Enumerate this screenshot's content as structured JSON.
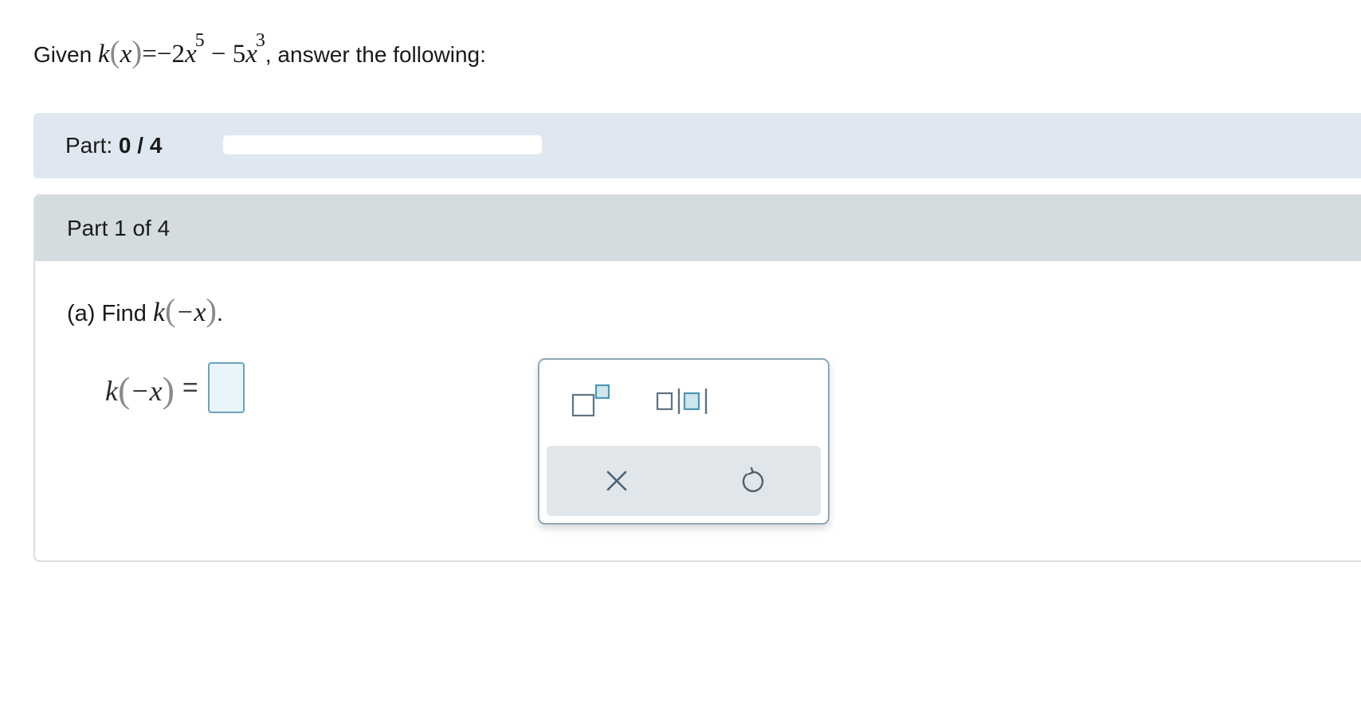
{
  "problem": {
    "prefix": "Given",
    "func_name": "k",
    "var": "x",
    "equals": "=",
    "minus1": "−",
    "coef1": "2",
    "exp1": "5",
    "minus2": "−",
    "coef2": "5",
    "exp2": "3",
    "suffix": ", answer the following:"
  },
  "progress": {
    "label": "Part:",
    "value_text": "0 / 4",
    "completed": 0,
    "total": 4,
    "fill_fraction": 0
  },
  "part": {
    "title": "Part 1 of 4",
    "question_prefix": "(a) Find",
    "func_name": "k",
    "arg": "−x",
    "question_suffix": ".",
    "answer_equals": "=",
    "answer_value": ""
  },
  "palette": {
    "buttons": [
      "superscript-icon",
      "absolute-value-icon",
      "clear-icon",
      "undo-icon"
    ]
  },
  "colors": {
    "progress_band": "#dfe8f0",
    "part_header": "#d5dce0",
    "input_border": "#6aa3bf",
    "input_fill": "#e9f4f8",
    "palette_border": "#8ea6b6",
    "icon_gray": "#5f7380",
    "icon_teal": "#4b97b4"
  }
}
